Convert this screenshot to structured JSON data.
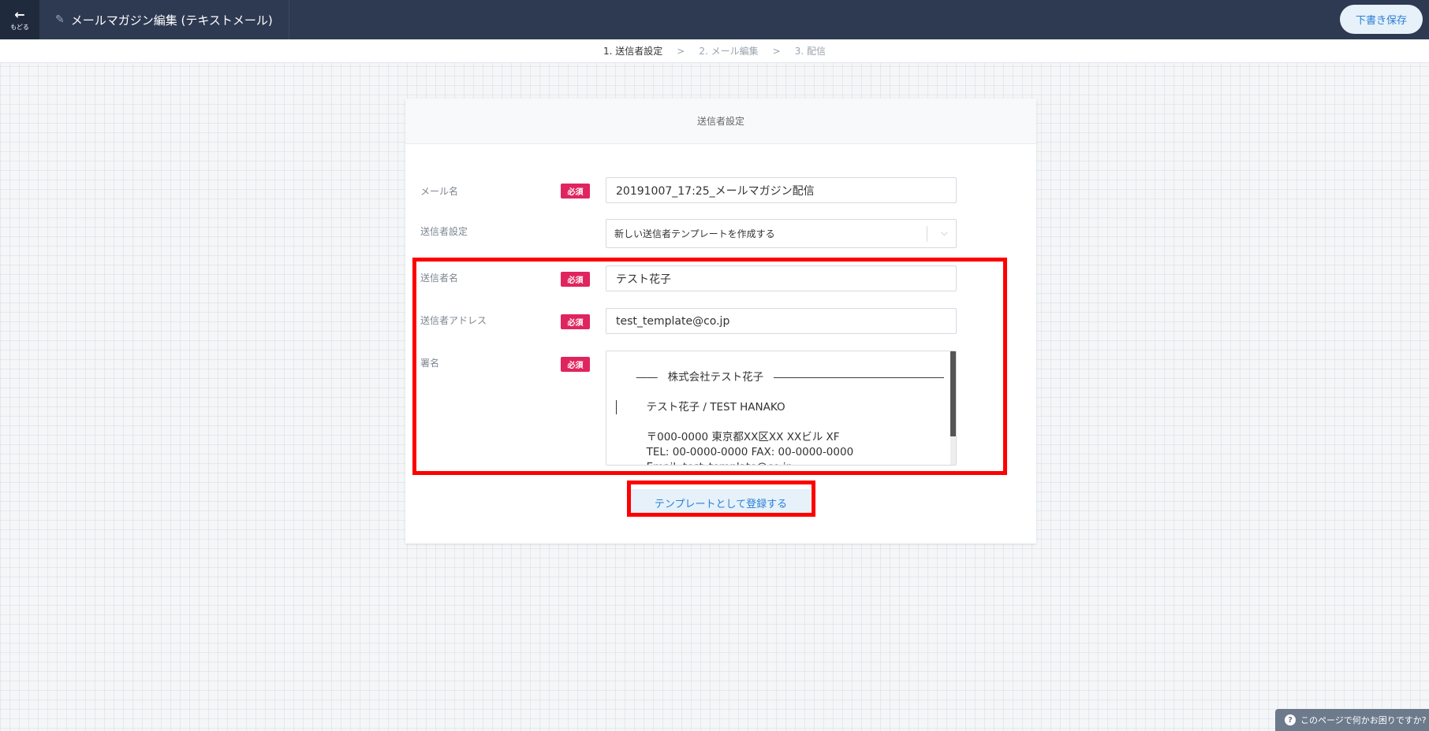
{
  "topbar": {
    "back_label": "もどる",
    "title": "メールマガジン編集 (テキストメール)",
    "draft_save": "下書き保存"
  },
  "steps": [
    "1. 送信者設定",
    ">",
    "2. メール編集",
    ">",
    "3. 配信"
  ],
  "card": {
    "header": "送信者設定",
    "required_badge": "必須",
    "mail_name": {
      "label": "メール名",
      "value": "20191007_17:25_メールマガジン配信"
    },
    "sender_setting": {
      "label": "送信者設定",
      "selected": "新しい送信者テンプレートを作成する"
    },
    "sender_name": {
      "label": "送信者名",
      "value": "テスト花子"
    },
    "sender_address": {
      "label": "送信者アドレス",
      "value": "test_template@co.jp"
    },
    "signature": {
      "label": "署名",
      "value": "――   株式会社テスト花子   ――――――――――――――――\n\n         テスト花子 / TEST HANAKO\n\n         〒000-0000 東京都XX区XX XXビル XF\n         TEL: 00-0000-0000 FAX: 00-0000-0000\n         Email: test_template@co.jp\n         URL: http://test_template.co.jp/"
    },
    "register_template": "テンプレートとして登録する"
  },
  "help": {
    "label": "このページで何かお困りですか?"
  },
  "colors": {
    "highlight": "#ff0000",
    "required": "#e0245e",
    "topbar": "#2e3a52",
    "accent": "#2b7fd4"
  },
  "icons": {
    "back": "arrow-left-icon",
    "edit": "pencil-icon",
    "dropdown": "chevron-down-icon",
    "help": "question-icon"
  }
}
